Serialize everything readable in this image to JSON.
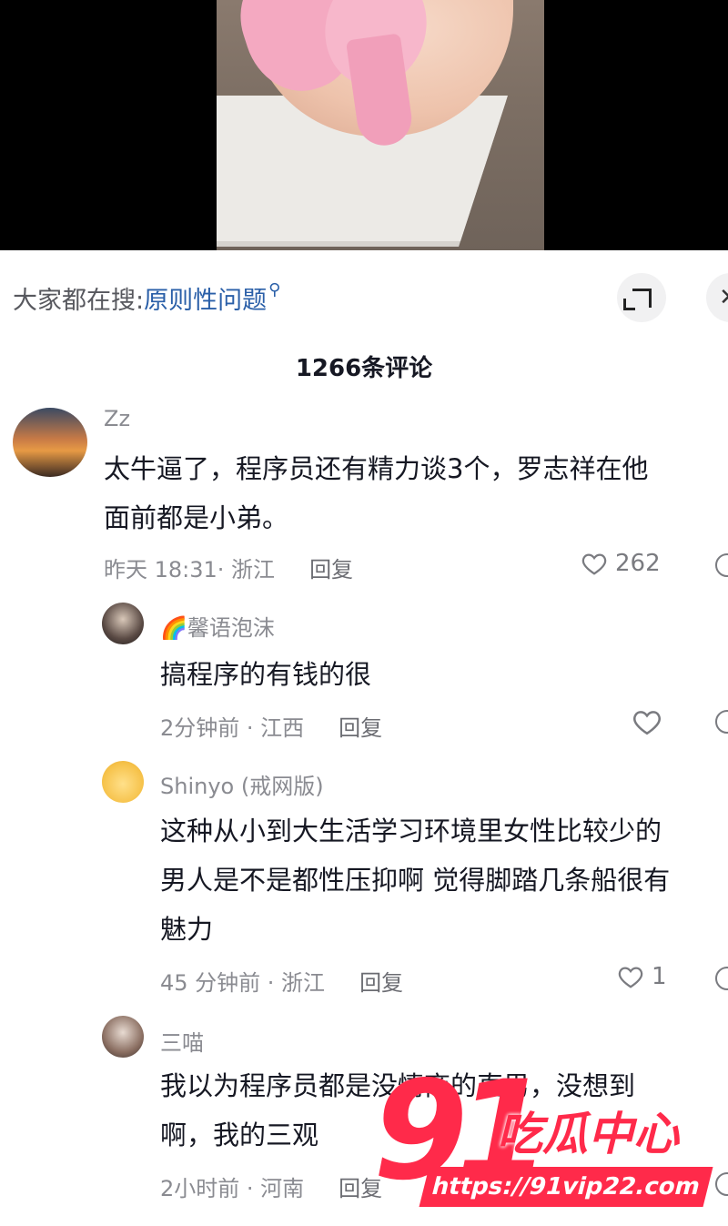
{
  "search": {
    "prefix": "大家都在搜:",
    "keyword": "原则性问题"
  },
  "comments_header": {
    "count_label": "1266条评论"
  },
  "comments": [
    {
      "user": "Zz",
      "lines": [
        "太牛逼了，程序员还有精力谈3个，罗志祥在他",
        "面前都是小弟。"
      ],
      "meta": "昨天 18:31· 浙江",
      "reply_label": "回复",
      "likes": "262"
    },
    {
      "user": "馨语泡沫",
      "lines": [
        "搞程序的有钱的很"
      ],
      "meta": "2分钟前 · 江西",
      "reply_label": "回复",
      "likes": ""
    },
    {
      "user": "Shinyo (戒网版)",
      "lines": [
        "这种从小到大生活学习环境里女性比较少的",
        "男人是不是都性压抑啊 觉得脚踏几条船很有",
        "魅力"
      ],
      "meta": "45 分钟前 · 浙江",
      "reply_label": "回复",
      "likes": "1"
    },
    {
      "user": "三喵",
      "lines": [
        "我以为程序员都是没情商的直男，没想到",
        "啊，我的三观"
      ],
      "meta": "2小时前 · 河南",
      "reply_label": "回复",
      "likes": ""
    }
  ],
  "watermark": {
    "number": "91",
    "title": "吃瓜中心",
    "url": "https://91vip22.com"
  },
  "icons": {
    "search": "search-icon",
    "expand": "expand-icon",
    "close": "close-icon",
    "like": "heart-icon",
    "dislike": "dislike-icon"
  },
  "colors": {
    "keyword": "#2a5fa8",
    "watermark": "#ff2a4a",
    "rainbow_emoji": "🌈"
  }
}
